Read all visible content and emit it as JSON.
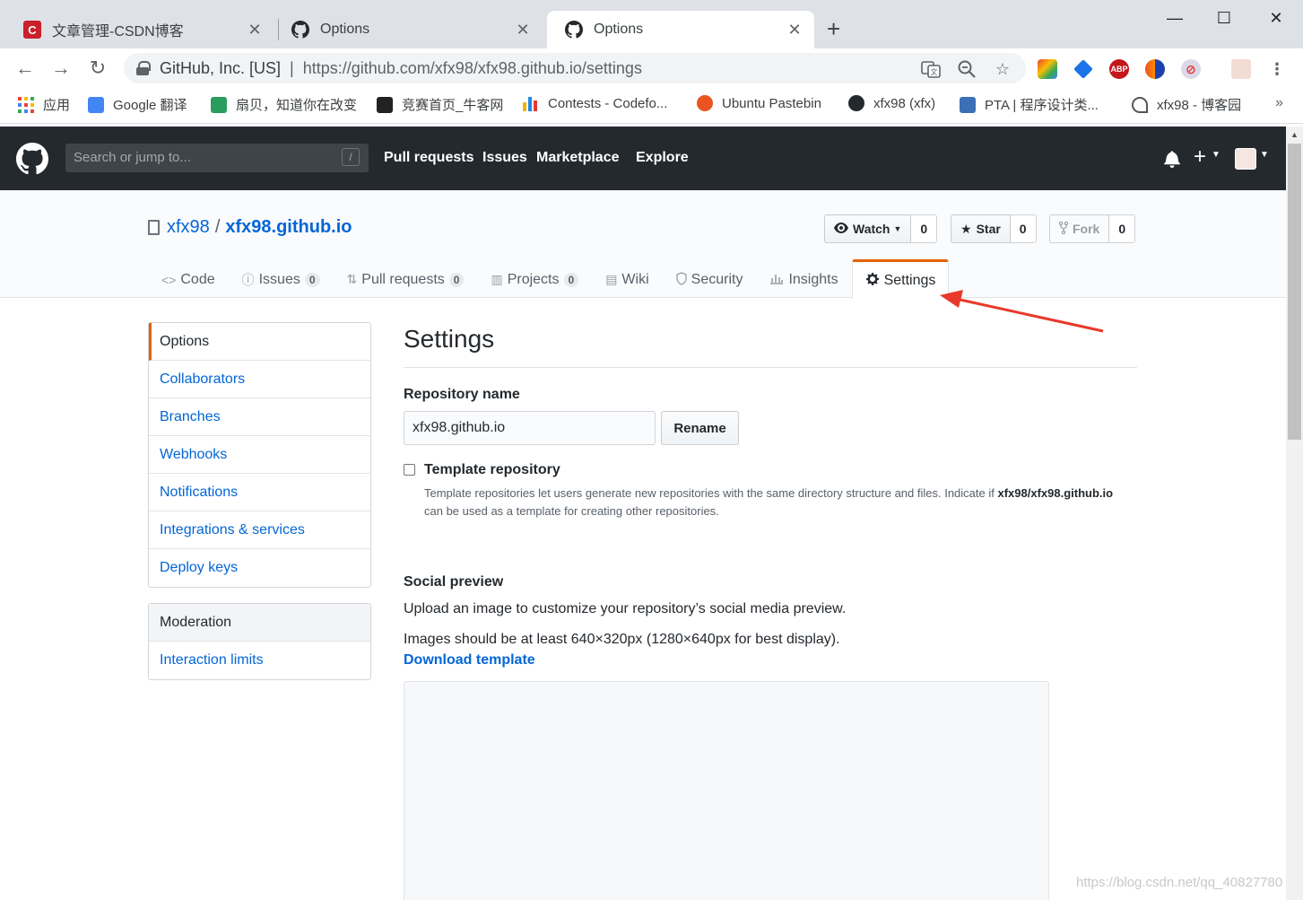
{
  "browser": {
    "tabs": [
      {
        "title": "文章管理-CSDN博客",
        "favicon": "csdn-icon",
        "active": false
      },
      {
        "title": "Options",
        "favicon": "github-icon",
        "active": false
      },
      {
        "title": "Options",
        "favicon": "github-icon",
        "active": true
      }
    ],
    "address": {
      "org": "GitHub, Inc. [US]",
      "url": "https://github.com/xfx98/xfx98.github.io/settings"
    },
    "bookmarks": [
      {
        "label": "应用",
        "icon": "apps-icon",
        "color": "#ea4335"
      },
      {
        "label": "Google 翻译",
        "icon": "google-translate-icon",
        "color": "#4285f4"
      },
      {
        "label": "扇贝，知道你在改变",
        "icon": "shanbay-icon",
        "color": "#2a9d5c"
      },
      {
        "label": "竞赛首页_牛客网",
        "icon": "nowcoder-icon",
        "color": "#222222"
      },
      {
        "label": "Contests - Codefo...",
        "icon": "codeforces-icon",
        "color": "#f4b400"
      },
      {
        "label": "Ubuntu Pastebin",
        "icon": "ubuntu-icon",
        "color": "#e95420"
      },
      {
        "label": "xfx98 (xfx)",
        "icon": "github-icon",
        "color": "#24292e"
      },
      {
        "label": "PTA | 程序设计类...",
        "icon": "pta-icon",
        "color": "#3b6fb6"
      },
      {
        "label": "xfx98 - 博客园",
        "icon": "cnblogs-icon",
        "color": "#555555"
      }
    ],
    "bookmarks_more": "»"
  },
  "github": {
    "search_placeholder": "Search or jump to...",
    "search_slash": "/",
    "nav": [
      "Pull requests",
      "Issues",
      "Marketplace",
      "Explore"
    ]
  },
  "repo": {
    "owner": "xfx98",
    "separator": "/",
    "name": "xfx98.github.io",
    "watch": {
      "label": "Watch",
      "count": "0"
    },
    "star": {
      "label": "Star",
      "count": "0"
    },
    "fork": {
      "label": "Fork",
      "count": "0"
    },
    "tabs": [
      {
        "label": "Code",
        "icon": "code-icon",
        "counter": null
      },
      {
        "label": "Issues",
        "icon": "issue-icon",
        "counter": "0"
      },
      {
        "label": "Pull requests",
        "icon": "pull-request-icon",
        "counter": "0"
      },
      {
        "label": "Projects",
        "icon": "project-icon",
        "counter": "0"
      },
      {
        "label": "Wiki",
        "icon": "wiki-icon",
        "counter": null
      },
      {
        "label": "Security",
        "icon": "shield-icon",
        "counter": null
      },
      {
        "label": "Insights",
        "icon": "graph-icon",
        "counter": null
      },
      {
        "label": "Settings",
        "icon": "gear-icon",
        "counter": null,
        "selected": true
      }
    ]
  },
  "sidebar": {
    "items": [
      "Options",
      "Collaborators",
      "Branches",
      "Webhooks",
      "Notifications",
      "Integrations & services",
      "Deploy keys"
    ],
    "moderation_heading": "Moderation",
    "moderation_items": [
      "Interaction limits"
    ]
  },
  "settings": {
    "title": "Settings",
    "repo_name_label": "Repository name",
    "repo_name_value": "xfx98.github.io",
    "rename_button": "Rename",
    "template_label": "Template repository",
    "template_note_pre": "Template repositories let users generate new repositories with the same directory structure and files. Indicate if ",
    "template_note_repo": "xfx98/xfx98.github.io",
    "template_note_post": " can be used as a template for creating other repositories.",
    "social_preview_label": "Social preview",
    "social_preview_desc": "Upload an image to customize your repository’s social media preview.",
    "social_preview_size": "Images should be at least 640×320px (1280×640px for best display).",
    "download_template": "Download template"
  },
  "watermark": "https://blog.csdn.net/qq_40827780",
  "colors": {
    "accent_tab": "#e36209",
    "link": "#0366d6",
    "header_bg": "#24292e",
    "annotation_arrow": "#e8392b"
  }
}
